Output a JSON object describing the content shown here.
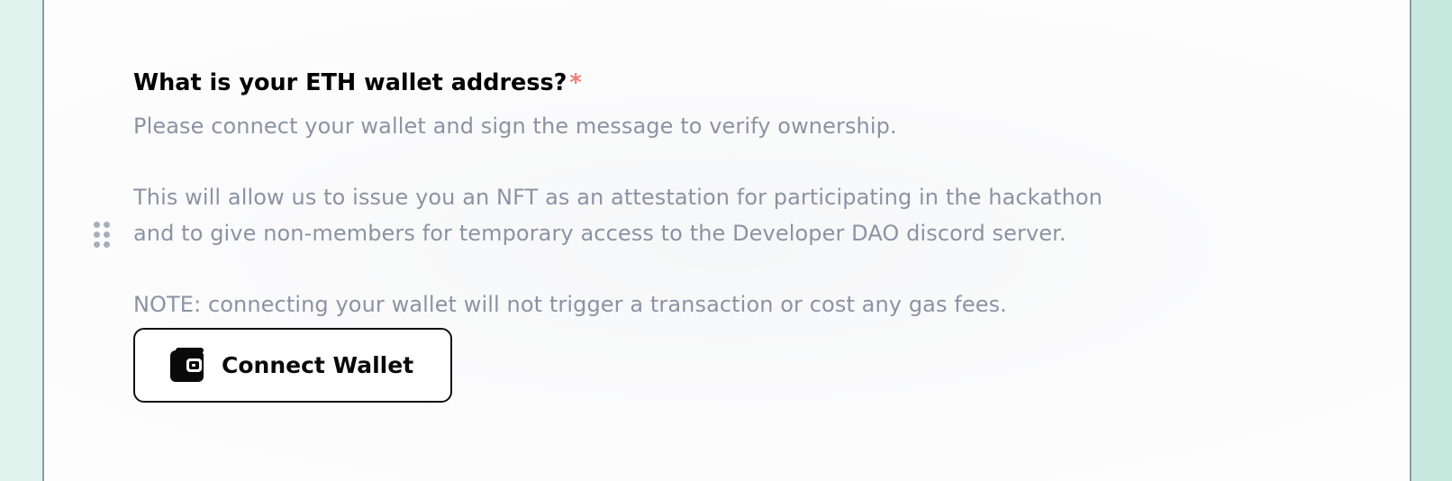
{
  "form": {
    "question": {
      "title": "What is your ETH wallet address?",
      "required_marker": "*",
      "description": [
        "Please connect your wallet and sign the message to verify ownership.",
        "This will allow us to issue you an NFT as an attestation for participating in the hackathon and to give non-members for temporary access to the Developer DAO discord server.",
        "NOTE: connecting your wallet will not trigger a transaction or cost any gas fees."
      ],
      "description_lines": [
        "Please connect your wallet and sign the message to verify ownership.",
        "This will allow us to issue you an NFT as an attestation for participating in the hackathon",
        "and to give non-members for temporary access to the Developer DAO discord server.",
        "NOTE: connecting your wallet will not trigger a transaction or cost any gas fees."
      ]
    },
    "connect_button": {
      "label": "Connect Wallet",
      "icon": "wallet-icon"
    },
    "drag_handle_icon": "drag-handle-icon"
  },
  "colors": {
    "title": "#000000",
    "required_star": "#f07b73",
    "description": "#8b93a3",
    "button_border": "#111111",
    "drag_dots": "#a7aebb",
    "card_border": "#8c9aa5",
    "page_background": "#d6efe7"
  }
}
